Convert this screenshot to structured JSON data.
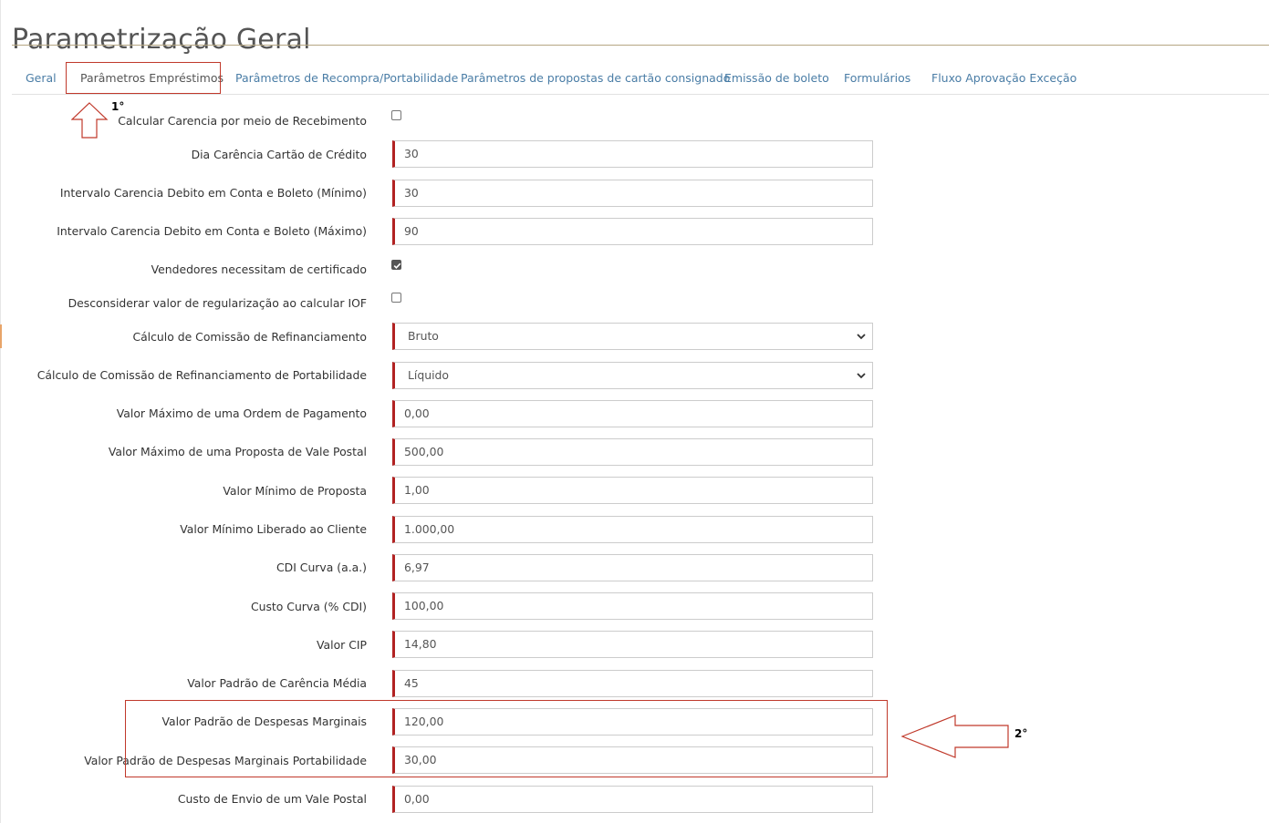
{
  "page": {
    "title": "Parametrização Geral"
  },
  "tabs": [
    {
      "label": "Geral",
      "active": false
    },
    {
      "label": "Parâmetros Empréstimos",
      "active": true
    },
    {
      "label": "Parâmetros de Recompra/Portabilidade",
      "active": false
    },
    {
      "label": "Parâmetros de propostas de cartão consignado",
      "active": false
    },
    {
      "label": "Emissão de boleto",
      "active": false
    },
    {
      "label": "Formulários",
      "active": false
    },
    {
      "label": "Fluxo Aprovação Exceção",
      "active": false
    }
  ],
  "fields": [
    {
      "label": "Calcular Carencia por meio de Recebimento",
      "type": "checkbox",
      "checked": false
    },
    {
      "label": "Dia Carência Cartão de Crédito",
      "type": "input",
      "value": "30"
    },
    {
      "label": "Intervalo Carencia Debito em Conta e Boleto (Mínimo)",
      "type": "input",
      "value": "30"
    },
    {
      "label": "Intervalo Carencia Debito em Conta e Boleto (Máximo)",
      "type": "input",
      "value": "90"
    },
    {
      "label": "Vendedores necessitam de certificado",
      "type": "checkbox",
      "checked": true
    },
    {
      "label": "Desconsiderar valor de regularização ao calcular IOF",
      "type": "checkbox",
      "checked": false
    },
    {
      "label": "Cálculo de Comissão de Refinanciamento",
      "type": "select",
      "value": "Bruto"
    },
    {
      "label": "Cálculo de Comissão de Refinanciamento de Portabilidade",
      "type": "select",
      "value": "Líquido"
    },
    {
      "label": "Valor Máximo de uma Ordem de Pagamento",
      "type": "input",
      "value": "0,00"
    },
    {
      "label": "Valor Máximo de uma Proposta de Vale Postal",
      "type": "input",
      "value": "500,00"
    },
    {
      "label": "Valor Mínimo de Proposta",
      "type": "input",
      "value": "1,00"
    },
    {
      "label": "Valor Mínimo Liberado ao Cliente",
      "type": "input",
      "value": "1.000,00"
    },
    {
      "label": "CDI Curva (a.a.)",
      "type": "input",
      "value": "6,97"
    },
    {
      "label": "Custo Curva (% CDI)",
      "type": "input",
      "value": "100,00"
    },
    {
      "label": "Valor CIP",
      "type": "input",
      "value": "14,80"
    },
    {
      "label": "Valor Padrão de Carência Média",
      "type": "input",
      "value": "45"
    },
    {
      "label": "Valor Padrão de Despesas Marginais",
      "type": "input",
      "value": "120,00"
    },
    {
      "label": "Valor Padrão de Despesas Marginais Portabilidade",
      "type": "input",
      "value": "30,00"
    },
    {
      "label": "Custo de Envio de um Vale Postal",
      "type": "input",
      "value": "0,00"
    }
  ],
  "annotations": {
    "step1": "1°",
    "step2": "2°"
  },
  "colors": {
    "required_marker": "#b22222",
    "tab_link": "#4a7da6",
    "annotation": "#c0392b"
  }
}
